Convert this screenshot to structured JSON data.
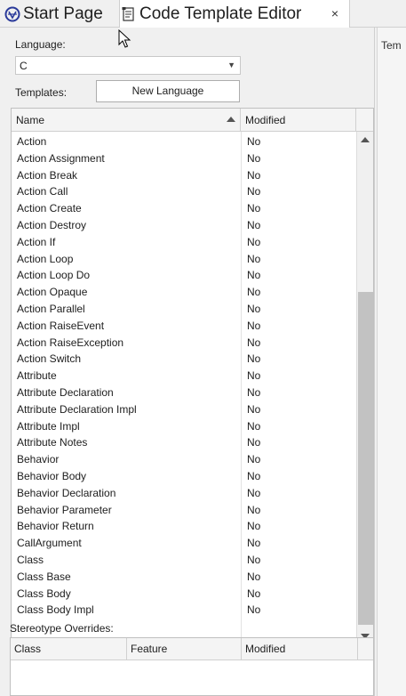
{
  "tabs": {
    "start_page": "Start Page",
    "code_template_editor": "Code Template Editor",
    "close_glyph": "×"
  },
  "form": {
    "language_label": "Language:",
    "language_value": "C",
    "templates_label": "Templates:",
    "new_language_button": "New Language"
  },
  "templates_grid": {
    "columns": {
      "name": "Name",
      "modified": "Modified"
    },
    "rows": [
      [
        "Action",
        "No"
      ],
      [
        "Action Assignment",
        "No"
      ],
      [
        "Action Break",
        "No"
      ],
      [
        "Action Call",
        "No"
      ],
      [
        "Action Create",
        "No"
      ],
      [
        "Action Destroy",
        "No"
      ],
      [
        "Action If",
        "No"
      ],
      [
        "Action Loop",
        "No"
      ],
      [
        "Action Loop Do",
        "No"
      ],
      [
        "Action Opaque",
        "No"
      ],
      [
        "Action Parallel",
        "No"
      ],
      [
        "Action RaiseEvent",
        "No"
      ],
      [
        "Action RaiseException",
        "No"
      ],
      [
        "Action Switch",
        "No"
      ],
      [
        "Attribute",
        "No"
      ],
      [
        "Attribute Declaration",
        "No"
      ],
      [
        "Attribute Declaration Impl",
        "No"
      ],
      [
        "Attribute Impl",
        "No"
      ],
      [
        "Attribute Notes",
        "No"
      ],
      [
        "Behavior",
        "No"
      ],
      [
        "Behavior Body",
        "No"
      ],
      [
        "Behavior Declaration",
        "No"
      ],
      [
        "Behavior Parameter",
        "No"
      ],
      [
        "Behavior Return",
        "No"
      ],
      [
        "CallArgument",
        "No"
      ],
      [
        "Class",
        "No"
      ],
      [
        "Class Base",
        "No"
      ],
      [
        "Class Body",
        "No"
      ],
      [
        "Class Body Impl",
        "No"
      ]
    ]
  },
  "stereotype_overrides": {
    "label": "Stereotype Overrides:",
    "columns": {
      "class": "Class",
      "feature": "Feature",
      "modified": "Modified"
    }
  },
  "right_panel": {
    "label": "Tem"
  },
  "icons": {
    "start_page_icon": "globe-icon",
    "code_template_icon": "document-icon",
    "dropdown_icon": "chevron-down-icon",
    "sort_icon": "sort-ascending-icon"
  },
  "colors": {
    "background": "#f0f0f0",
    "grid_background": "#ffffff",
    "start_icon": "#2a3a9a"
  }
}
